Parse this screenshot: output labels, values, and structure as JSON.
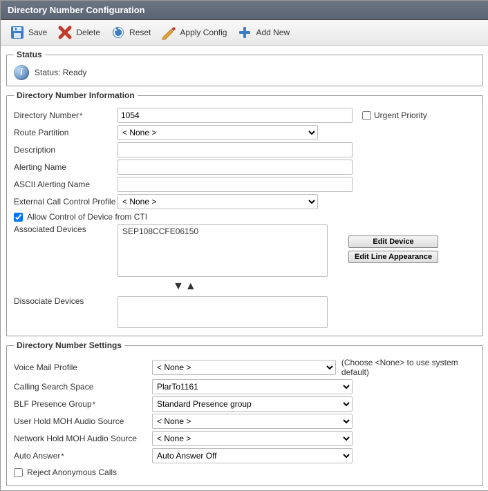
{
  "page_title": "Directory Number Configuration",
  "toolbar": {
    "save": "Save",
    "delete": "Delete",
    "reset": "Reset",
    "apply_config": "Apply Config",
    "add_new": "Add New"
  },
  "status": {
    "legend": "Status",
    "text": "Status: Ready"
  },
  "dn_info": {
    "legend": "Directory Number Information",
    "directory_number_label": "Directory Number",
    "directory_number_value": "1054",
    "urgent_priority_label": "Urgent Priority",
    "urgent_priority_checked": false,
    "route_partition_label": "Route Partition",
    "route_partition_value": "< None >",
    "description_label": "Description",
    "description_value": "",
    "alerting_name_label": "Alerting Name",
    "alerting_name_value": "",
    "ascii_alerting_name_label": "ASCII Alerting Name",
    "ascii_alerting_name_value": "",
    "ext_call_ctrl_label": "External Call Control Profile",
    "ext_call_ctrl_value": "< None >",
    "allow_cti_label": "Allow Control of Device from CTI",
    "allow_cti_checked": true,
    "associated_devices_label": "Associated Devices",
    "associated_devices_item": "SEP108CCFE06150",
    "edit_device_label": "Edit Device",
    "edit_line_appearance_label": "Edit Line Appearance",
    "dissociate_devices_label": "Dissociate Devices"
  },
  "dn_settings": {
    "legend": "Directory Number Settings",
    "voice_mail_profile_label": "Voice Mail Profile",
    "voice_mail_profile_value": "< None >",
    "voice_mail_profile_hint": "(Choose <None> to use system default)",
    "calling_search_space_label": "Calling Search Space",
    "calling_search_space_value": "PlarTo1161",
    "blf_presence_group_label": "BLF Presence Group",
    "blf_presence_group_value": "Standard Presence group",
    "user_hold_moh_label": "User Hold MOH Audio Source",
    "user_hold_moh_value": "< None >",
    "network_hold_moh_label": "Network Hold MOH Audio Source",
    "network_hold_moh_value": "< None >",
    "auto_answer_label": "Auto Answer",
    "auto_answer_value": "Auto Answer Off",
    "reject_anon_label": "Reject Anonymous Calls",
    "reject_anon_checked": false
  }
}
